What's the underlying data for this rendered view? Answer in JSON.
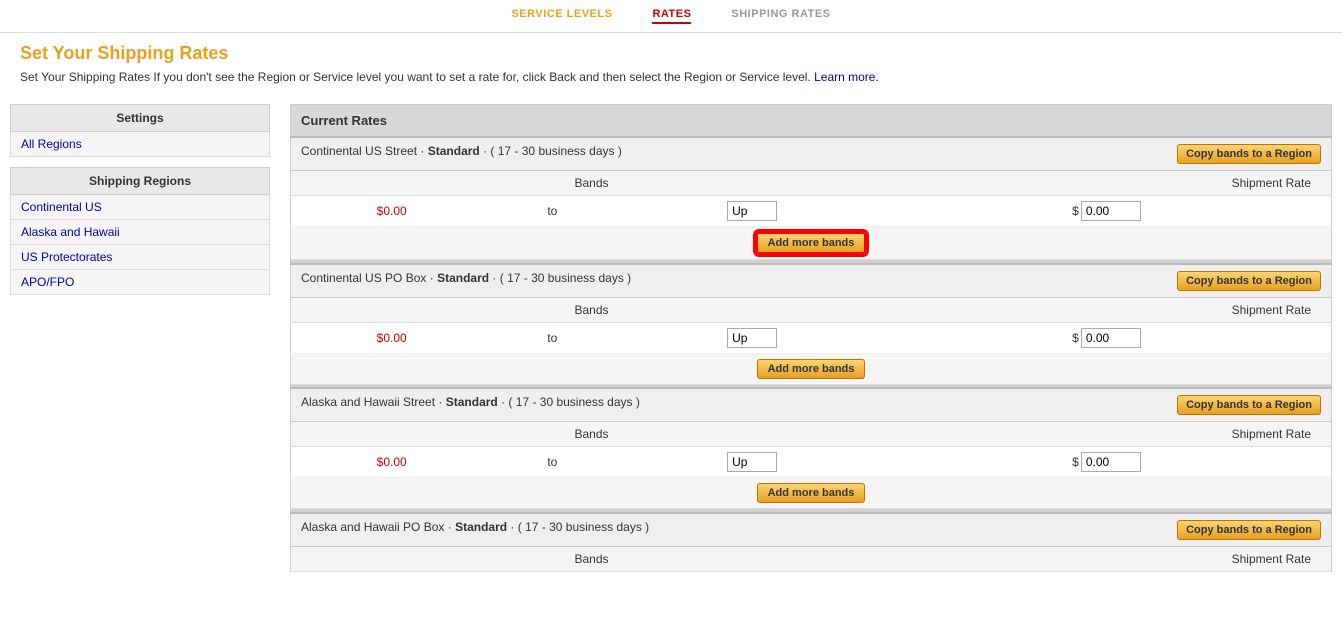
{
  "nav": {
    "items": [
      {
        "label": "SERVICE LEVELS",
        "state": "inactive"
      },
      {
        "label": "RATES",
        "state": "active"
      },
      {
        "label": "SHIPPING RATES",
        "state": "gray"
      }
    ]
  },
  "header": {
    "title": "Set Your Shipping Rates",
    "description": "Set Your Shipping Rates If you don't see the Region or Service level you want to set a rate for, click Back and then select the Region or Service level.",
    "learn_more": "Learn more."
  },
  "sidebar": {
    "settings_label": "Settings",
    "all_regions_label": "All Regions",
    "shipping_regions_label": "Shipping Regions",
    "regions": [
      {
        "label": "Continental US"
      },
      {
        "label": "Alaska and Hawaii"
      },
      {
        "label": "US Protectorates"
      },
      {
        "label": "APO/FPO"
      }
    ]
  },
  "current_rates_label": "Current Rates",
  "rate_sections": [
    {
      "title": "Continental US Street",
      "service": "Standard",
      "days": "17 - 30 business days",
      "copy_btn": "Copy bands to a Region",
      "bands_label": "Bands",
      "shipment_rate_label": "Shipment Rate",
      "from": "$0.00",
      "to_label": "to",
      "up_value": "Up",
      "rate_value": "0.00",
      "add_more_label": "Add more bands",
      "highlighted": true
    },
    {
      "title": "Continental US PO Box",
      "service": "Standard",
      "days": "17 - 30 business days",
      "copy_btn": "Copy bands to a Region",
      "bands_label": "Bands",
      "shipment_rate_label": "Shipment Rate",
      "from": "$0.00",
      "to_label": "to",
      "up_value": "Up",
      "rate_value": "0.00",
      "add_more_label": "Add more bands",
      "highlighted": false
    },
    {
      "title": "Alaska and Hawaii Street",
      "service": "Standard",
      "days": "17 - 30 business days",
      "copy_btn": "Copy bands to a Region",
      "bands_label": "Bands",
      "shipment_rate_label": "Shipment Rate",
      "from": "$0.00",
      "to_label": "to",
      "up_value": "Up",
      "rate_value": "0.00",
      "add_more_label": "Add more bands",
      "highlighted": false
    },
    {
      "title": "Alaska and Hawaii PO Box",
      "service": "Standard",
      "days": "17 - 30 business days",
      "copy_btn": "Copy bands to a Region",
      "bands_label": "Bands",
      "shipment_rate_label": "Shipment Rate",
      "highlighted": false
    }
  ]
}
